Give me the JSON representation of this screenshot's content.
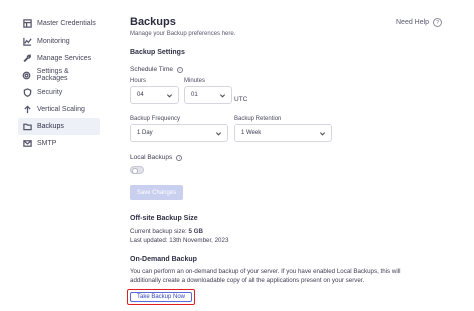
{
  "sidebar": {
    "items": [
      {
        "label": "Master Credentials",
        "icon": "grid-icon"
      },
      {
        "label": "Monitoring",
        "icon": "chart-icon"
      },
      {
        "label": "Manage Services",
        "icon": "wrench-icon"
      },
      {
        "label": "Settings & Packages",
        "icon": "gear-icon"
      },
      {
        "label": "Security",
        "icon": "shield-icon"
      },
      {
        "label": "Vertical Scaling",
        "icon": "arrow-up-icon"
      },
      {
        "label": "Backups",
        "icon": "folder-icon",
        "active": true
      },
      {
        "label": "SMTP",
        "icon": "mail-icon"
      }
    ]
  },
  "header": {
    "title": "Backups",
    "subtitle": "Manage your Backup preferences here.",
    "help_label": "Need Help",
    "help_glyph": "?"
  },
  "backup_settings": {
    "title": "Backup Settings",
    "schedule_label": "Schedule Time",
    "hours_label": "Hours",
    "hours_value": "04",
    "minutes_label": "Minutes",
    "minutes_value": "01",
    "timezone": "UTC",
    "frequency_label": "Backup Frequency",
    "frequency_value": "1 Day",
    "retention_label": "Backup Retention",
    "retention_value": "1 Week",
    "local_label": "Local Backups",
    "info_glyph": "i",
    "local_enabled": false,
    "save_label": "Save Changes"
  },
  "offsite": {
    "title": "Off-site Backup Size",
    "size_prefix": "Current backup size: ",
    "size_value": "5 GB",
    "updated": "Last updated: 13th November, 2023"
  },
  "on_demand": {
    "title": "On-Demand Backup",
    "line1": "You can perform an on-demand backup of your server. If you have enabled Local Backups, this will",
    "line2": "additionally create a downloadable copy of all the applications present on your server.",
    "button_label": "Take Backup Now"
  },
  "colors": {
    "accent": "#3344b8",
    "disabled_button": "#c9cfee",
    "highlight": "#e02020",
    "active_nav_bg": "#eef0f8"
  }
}
